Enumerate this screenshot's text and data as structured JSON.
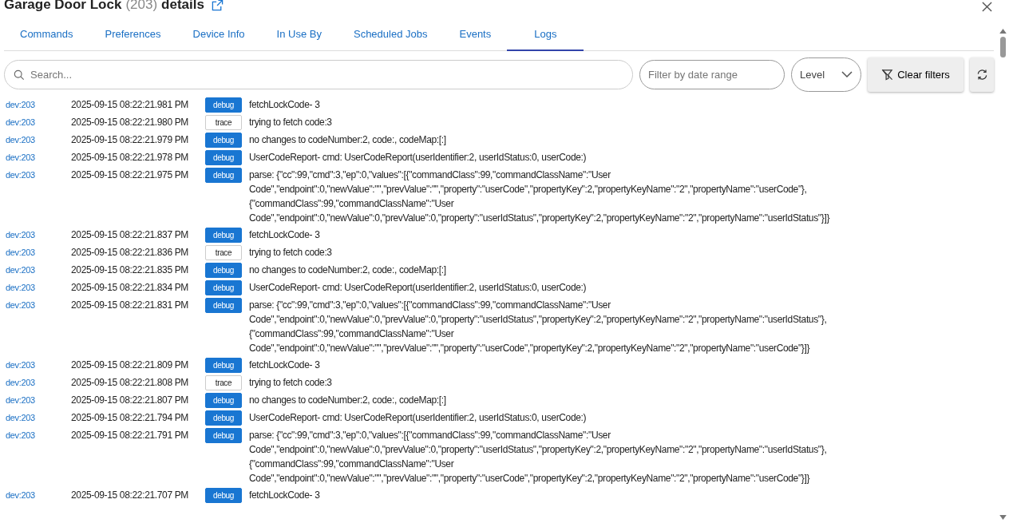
{
  "header": {
    "title": "Garage Door Lock",
    "device_id": "(203)",
    "title_suffix": "details"
  },
  "tabs": [
    {
      "label": "Commands",
      "selected": false
    },
    {
      "label": "Preferences",
      "selected": false
    },
    {
      "label": "Device Info",
      "selected": false
    },
    {
      "label": "In Use By",
      "selected": false
    },
    {
      "label": "Scheduled Jobs",
      "selected": false
    },
    {
      "label": "Events",
      "selected": false
    },
    {
      "label": "Logs",
      "selected": true
    }
  ],
  "filters": {
    "search_placeholder": "Search...",
    "date_placeholder": "Filter by date range",
    "level_select": "Level",
    "clear_button": "Clear filters"
  },
  "logs": [
    {
      "device": "dev:203",
      "time": "2025-09-15 08:22:21.981 PM",
      "kind": "debug",
      "label": "debug",
      "message": "fetchLockCode- 3"
    },
    {
      "device": "dev:203",
      "time": "2025-09-15 08:22:21.980 PM",
      "kind": "trace",
      "label": "trace",
      "message": "trying to fetch code:3"
    },
    {
      "device": "dev:203",
      "time": "2025-09-15 08:22:21.979 PM",
      "kind": "debug",
      "label": "debug",
      "message": "no changes to codeNumber:2, code:, codeMap:[:]"
    },
    {
      "device": "dev:203",
      "time": "2025-09-15 08:22:21.978 PM",
      "kind": "debug",
      "label": "debug",
      "message": "UserCodeReport- cmd: UserCodeReport(userIdentifier:2, userIdStatus:0, userCode:)"
    },
    {
      "device": "dev:203",
      "time": "2025-09-15 08:22:21.975 PM",
      "kind": "debug",
      "label": "debug",
      "message": "parse: {\"cc\":99,\"cmd\":3,\"ep\":0,\"values\":[{\"commandClass\":99,\"commandClassName\":\"User Code\",\"endpoint\":0,\"newValue\":\"\",\"prevValue\":\"\",\"property\":\"userCode\",\"propertyKey\":2,\"propertyKeyName\":\"2\",\"propertyName\":\"userCode\"},{\"commandClass\":99,\"commandClassName\":\"User Code\",\"endpoint\":0,\"newValue\":0,\"prevValue\":0,\"property\":\"userIdStatus\",\"propertyKey\":2,\"propertyKeyName\":\"2\",\"propertyName\":\"userIdStatus\"}]}"
    },
    {
      "device": "dev:203",
      "time": "2025-09-15 08:22:21.837 PM",
      "kind": "debug",
      "label": "debug",
      "message": "fetchLockCode- 3"
    },
    {
      "device": "dev:203",
      "time": "2025-09-15 08:22:21.836 PM",
      "kind": "trace",
      "label": "trace",
      "message": "trying to fetch code:3"
    },
    {
      "device": "dev:203",
      "time": "2025-09-15 08:22:21.835 PM",
      "kind": "debug",
      "label": "debug",
      "message": "no changes to codeNumber:2, code:, codeMap:[:]"
    },
    {
      "device": "dev:203",
      "time": "2025-09-15 08:22:21.834 PM",
      "kind": "debug",
      "label": "debug",
      "message": "UserCodeReport- cmd: UserCodeReport(userIdentifier:2, userIdStatus:0, userCode:)"
    },
    {
      "device": "dev:203",
      "time": "2025-09-15 08:22:21.831 PM",
      "kind": "debug",
      "label": "debug",
      "message": "parse: {\"cc\":99,\"cmd\":3,\"ep\":0,\"values\":[{\"commandClass\":99,\"commandClassName\":\"User Code\",\"endpoint\":0,\"newValue\":0,\"prevValue\":0,\"property\":\"userIdStatus\",\"propertyKey\":2,\"propertyKeyName\":\"2\",\"propertyName\":\"userIdStatus\"},{\"commandClass\":99,\"commandClassName\":\"User Code\",\"endpoint\":0,\"newValue\":\"\",\"prevValue\":\"\",\"property\":\"userCode\",\"propertyKey\":2,\"propertyKeyName\":\"2\",\"propertyName\":\"userCode\"}]}"
    },
    {
      "device": "dev:203",
      "time": "2025-09-15 08:22:21.809 PM",
      "kind": "debug",
      "label": "debug",
      "message": "fetchLockCode- 3"
    },
    {
      "device": "dev:203",
      "time": "2025-09-15 08:22:21.808 PM",
      "kind": "trace",
      "label": "trace",
      "message": "trying to fetch code:3"
    },
    {
      "device": "dev:203",
      "time": "2025-09-15 08:22:21.807 PM",
      "kind": "debug",
      "label": "debug",
      "message": "no changes to codeNumber:2, code:, codeMap:[:]"
    },
    {
      "device": "dev:203",
      "time": "2025-09-15 08:22:21.794 PM",
      "kind": "debug",
      "label": "debug",
      "message": "UserCodeReport- cmd: UserCodeReport(userIdentifier:2, userIdStatus:0, userCode:)"
    },
    {
      "device": "dev:203",
      "time": "2025-09-15 08:22:21.791 PM",
      "kind": "debug",
      "label": "debug",
      "message": "parse: {\"cc\":99,\"cmd\":3,\"ep\":0,\"values\":[{\"commandClass\":99,\"commandClassName\":\"User Code\",\"endpoint\":0,\"newValue\":0,\"prevValue\":0,\"property\":\"userIdStatus\",\"propertyKey\":2,\"propertyKeyName\":\"2\",\"propertyName\":\"userIdStatus\"},{\"commandClass\":99,\"commandClassName\":\"User Code\",\"endpoint\":0,\"newValue\":\"\",\"prevValue\":\"\",\"property\":\"userCode\",\"propertyKey\":2,\"propertyKeyName\":\"2\",\"propertyName\":\"userCode\"}]}"
    },
    {
      "device": "dev:203",
      "time": "2025-09-15 08:22:21.707 PM",
      "kind": "debug",
      "label": "debug",
      "message": "fetchLockCode- 3"
    }
  ]
}
